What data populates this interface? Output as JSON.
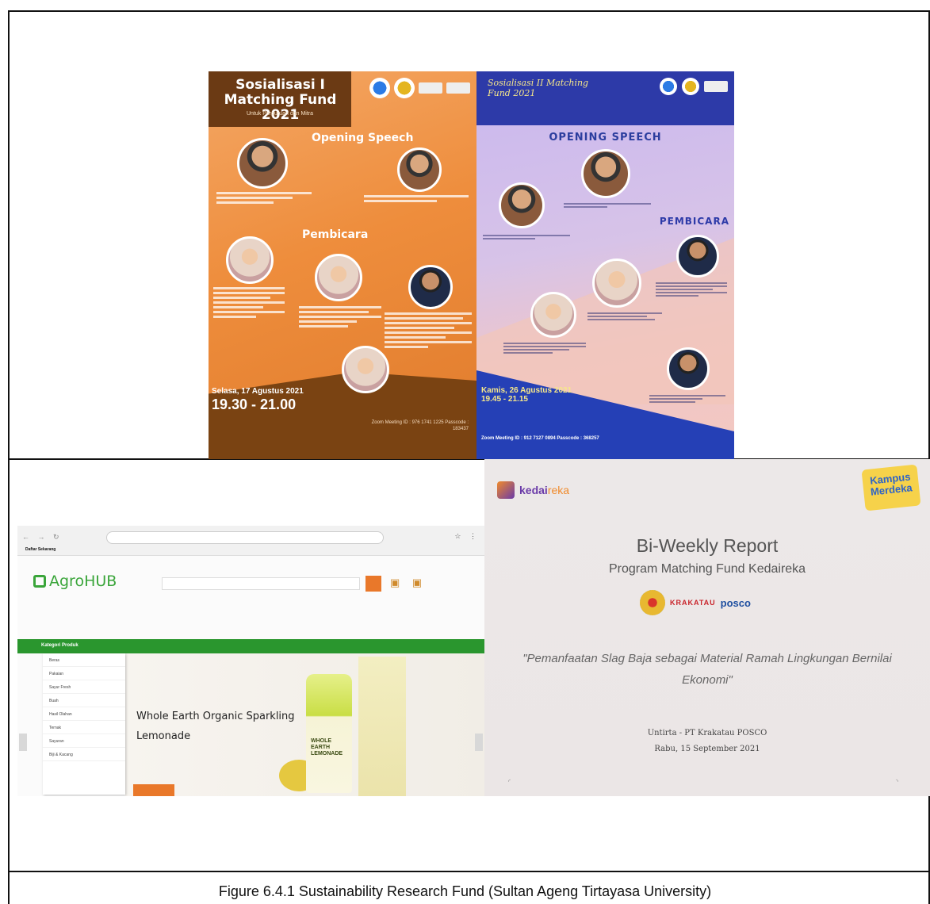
{
  "poster1": {
    "title": "Sosialisasi I Matching Fund 2021",
    "subtitle": "Untuk Perguruan dan Mitra",
    "opening": "Opening Speech",
    "speakers_heading": "Pembicara",
    "date": "Selasa, 17 Agustus 2021",
    "time": "19.30 - 21.00",
    "zoom": "Zoom Meeting ID : 976 1741 1225 Passcode : 183437"
  },
  "poster2": {
    "title": "Sosialisasi II Matching Fund 2021",
    "opening": "OPENING SPEECH",
    "speakers_heading": "PEMBICARA",
    "date": "Kamis, 26 Agustus 2021",
    "time": "19.45 - 21.15",
    "zoom": "Zoom Meeting ID : 912 7127 0894 Passcode : 368257"
  },
  "agrohub": {
    "brand": "AgroHUB",
    "bookmark": "Daftar Sekarang",
    "category_menu": "Kategori Produk",
    "menu_items": [
      "Beras",
      "Pakaian",
      "Sayur Fresh",
      "Buah",
      "Hasil Olahan",
      "Ternak",
      "Sayuran",
      "Biji & Kacang"
    ],
    "hero_title_line1": "Whole Earth Organic Sparkling",
    "hero_title_line2": "Lemonade",
    "can_label": "WHOLE EARTH LEMONADE"
  },
  "kedaireka": {
    "brand_a": "kedai",
    "brand_b": "reka",
    "kampus_line1": "Kampus",
    "kampus_line2": "Merdeka",
    "title": "Bi-Weekly Report",
    "subtitle": "Program Matching Fund Kedaireka",
    "partner_a": "KRAKATAU",
    "partner_b": "posco",
    "quote": "\"Pemanfaatan Slag Baja sebagai Material Ramah Lingkungan Bernilai Ekonomi\"",
    "team": "Untirta - PT Krakatau POSCO",
    "date": "Rabu, 15 September 2021"
  },
  "caption": "Figure 6.4.1 Sustainability Research Fund (Sultan Ageng Tirtayasa University)"
}
